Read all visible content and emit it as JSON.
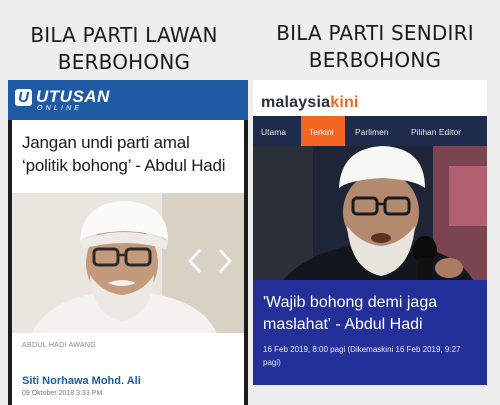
{
  "captions": {
    "left": [
      "BILA PARTI LAWAN",
      "BERBOHONG"
    ],
    "right": [
      "BILA PARTI SENDIRI",
      "BERBOHONG"
    ]
  },
  "utusan": {
    "logo_letter": "U",
    "logo_name": "UTUSAN",
    "logo_sub": "ONLINE",
    "headline": "Jangan undi parti amal ‘politik bohong’ - Abdul Hadi",
    "photo_caption": "ABDUL HADI AWANG",
    "author": "Siti Norhawa Mohd. Ali",
    "date": "09 Oktober 2018 3:33 PM",
    "brand_color": "#1f5aa5"
  },
  "malaysiakini": {
    "logo_main": "malaysia",
    "logo_accent": "kini",
    "tabs": [
      "Utama",
      "Terkini",
      "Parlimen",
      "Pilihan Editor"
    ],
    "active_tab": "Terkini",
    "headline": "'Wajib bohong demi jaga maslahat' - Abdul Hadi",
    "date": "16 Feb 2019, 8:00 pagi (Dikemaskini 16 Feb 2019, 9:27 pagi)",
    "nav_color": "#1f2b4a",
    "accent_color": "#f26522",
    "panel_color": "#23309a"
  }
}
